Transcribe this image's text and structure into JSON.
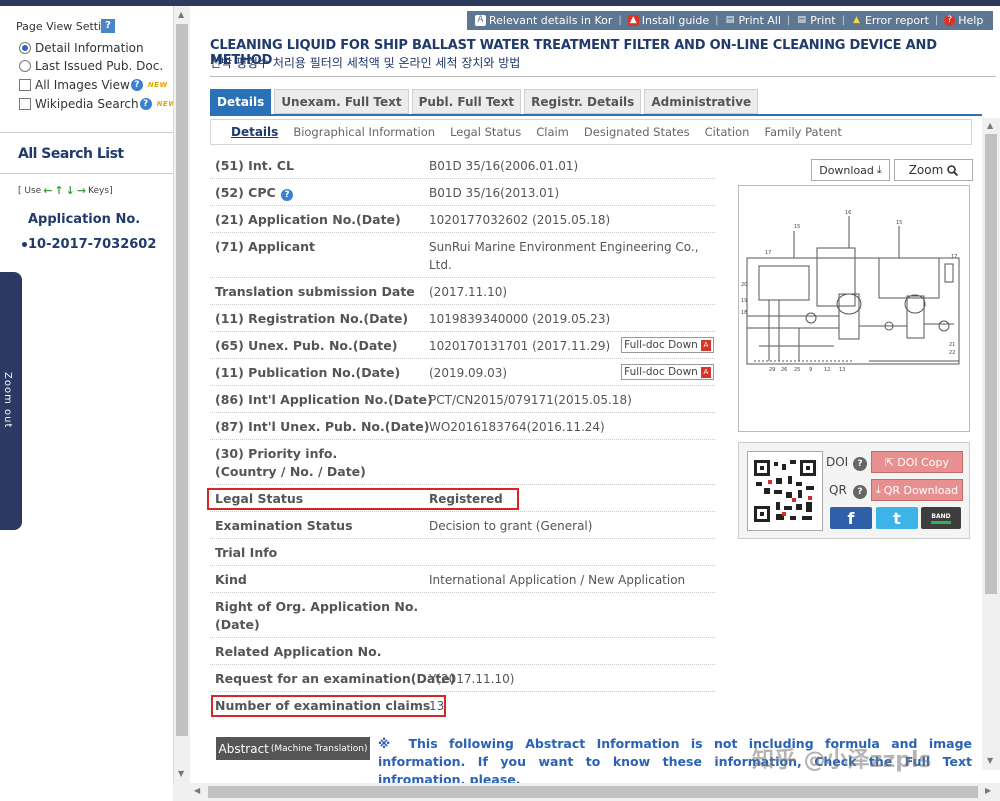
{
  "left_panel": {
    "page_view_title": "Page View Setting",
    "help_glyph": "?",
    "options": [
      {
        "label": "Detail Information",
        "type": "radio",
        "checked": true
      },
      {
        "label": "Last Issued Pub. Doc.",
        "type": "radio",
        "checked": false
      },
      {
        "label": "All Images View",
        "type": "checkbox",
        "checked": false,
        "badge": "NEW"
      },
      {
        "label": "Wikipedia Search",
        "type": "checkbox",
        "checked": false,
        "badge": "NEW"
      }
    ],
    "all_search_list": "All Search List",
    "keys_hint_prefix": "[ Use",
    "keys_hint_suffix": "Keys]",
    "app_no_label": "Application No.",
    "app_no_value": "10-2017-7032602",
    "zoom_out": "Zoom out"
  },
  "toolbar": {
    "items": [
      {
        "label": "Relevant details in Kor",
        "icon": "translate-icon"
      },
      {
        "label": "Install guide",
        "icon": "pdf-icon"
      },
      {
        "label": "Print All",
        "icon": "printer-icon"
      },
      {
        "label": "Print",
        "icon": "printer-icon"
      },
      {
        "label": "Error report",
        "icon": "warning-icon"
      },
      {
        "label": "Help",
        "icon": "help-icon"
      }
    ]
  },
  "header": {
    "title_en": "CLEANING LIQUID FOR SHIP BALLAST WATER TREATMENT FILTER AND ON-LINE CLEANING DEVICE AND METHOD",
    "title_ko": "선박 평형수 처리용 필터의 세척액 및 온라인 세척 장치와 방법"
  },
  "tabs": [
    "Details",
    "Unexam. Full Text",
    "Publ. Full Text",
    "Registr. Details",
    "Administrative"
  ],
  "subtabs": [
    "Details",
    "Biographical Information",
    "Legal Status",
    "Claim",
    "Designated States",
    "Citation",
    "Family Patent"
  ],
  "details": {
    "int_cl": {
      "label": "(51) Int. CL",
      "value": "B01D 35/16(2006.01.01)"
    },
    "cpc": {
      "label": "(52) CPC",
      "value": "B01D 35/16(2013.01)"
    },
    "application_no": {
      "label": "(21) Application No.(Date)",
      "value": "1020177032602 (2015.05.18)"
    },
    "applicant": {
      "label": "(71) Applicant",
      "value_line1": "SunRui Marine Environment Engineering Co.,",
      "value_line2": "Ltd."
    },
    "translation_date": {
      "label": "Translation submission Date",
      "value": "(2017.11.10)"
    },
    "registration_no": {
      "label": "(11) Registration No.(Date)",
      "value": "1019839340000 (2019.05.23)"
    },
    "unex_pub_no": {
      "label": "(65) Unex. Pub. No.(Date)",
      "value": "1020170131701 (2017.11.29)"
    },
    "publication_no": {
      "label": "(11) Publication No.(Date)",
      "value": "(2019.09.03)"
    },
    "intl_application_no": {
      "label": "(86) Int'l Application No.(Date)",
      "value": "PCT/CN2015/079171(2015.05.18)"
    },
    "intl_unex_pub_no": {
      "label": "(87) Int'l Unex. Pub. No.(Date)",
      "value": "WO2016183764(2016.11.24)"
    },
    "priority_info": {
      "label_line1": "(30) Priority info.",
      "label_line2": "(Country / No. / Date)",
      "value": ""
    },
    "legal_status": {
      "label": "Legal Status",
      "value": "Registered"
    },
    "examination_status": {
      "label": "Examination Status",
      "value": "Decision to grant (General)"
    },
    "trial_info": {
      "label": "Trial Info",
      "value": ""
    },
    "kind": {
      "label": "Kind",
      "value": "International Application / New Application"
    },
    "right_of_org": {
      "label_line1": "Right of Org. Application No.",
      "label_line2": "(Date)",
      "value": ""
    },
    "related_application": {
      "label": "Related Application No.",
      "value": ""
    },
    "request_exam": {
      "label": "Request for an examination(Date)",
      "value": "Y(2017.11.10)"
    },
    "num_claims": {
      "label": "Number of examination claims",
      "value": "13"
    },
    "fulldoc_label": "Full-doc Down"
  },
  "side_panel": {
    "download": "Download",
    "zoom": "Zoom",
    "doi": "DOI",
    "qr": "QR",
    "doi_copy": "DOI Copy",
    "qr_download": "QR Download",
    "band": "BAND"
  },
  "abstract": {
    "button": "Abstract",
    "button_sub": "(Machine Translation)",
    "note": "※ This following Abstract Information is not including formula and image information. If you want to know these information, Check the Full Text infromation, please."
  },
  "watermark": "知乎 @小泽zzpls",
  "colors": {
    "accent": "#2a71b8",
    "navy": "#1f3a6b",
    "highlight": "#d62626",
    "toolbar": "#5d7691"
  }
}
